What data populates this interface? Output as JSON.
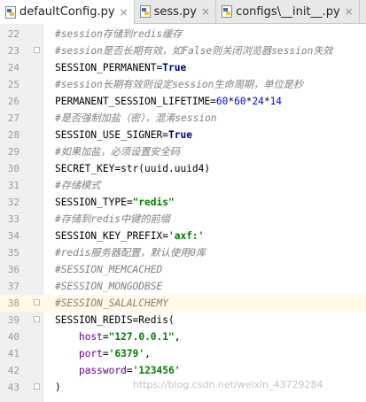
{
  "tabs": [
    {
      "label": "defaultConfig.py",
      "close": "×",
      "active": true
    },
    {
      "label": "sess.py",
      "close": "×",
      "active": false
    },
    {
      "label": "configs\\__init__.py",
      "close": "×",
      "active": false
    },
    {
      "label": "r",
      "close": "",
      "active": false
    }
  ],
  "lines": [
    {
      "num": "22",
      "segments": [
        {
          "t": "#session存储到redis缓存",
          "c": "comment"
        }
      ]
    },
    {
      "num": "23",
      "segments": [
        {
          "t": "#session是否长期有效，如False则关闭浏览器session失效",
          "c": "comment"
        }
      ]
    },
    {
      "num": "24",
      "segments": [
        {
          "t": "SESSION_PERMANENT=",
          "c": ""
        },
        {
          "t": "True",
          "c": "kw"
        }
      ]
    },
    {
      "num": "25",
      "segments": [
        {
          "t": "#session长期有效则设定session生命周期，单位是秒",
          "c": "comment"
        }
      ]
    },
    {
      "num": "26",
      "segments": [
        {
          "t": "PERMANENT_SESSION_LIFETIME=",
          "c": ""
        },
        {
          "t": "60",
          "c": "num"
        },
        {
          "t": "*",
          "c": ""
        },
        {
          "t": "60",
          "c": "num"
        },
        {
          "t": "*",
          "c": ""
        },
        {
          "t": "24",
          "c": "num"
        },
        {
          "t": "*",
          "c": ""
        },
        {
          "t": "14",
          "c": "num"
        }
      ]
    },
    {
      "num": "27",
      "segments": [
        {
          "t": "#是否强制加盐（密），混淆session",
          "c": "comment"
        }
      ]
    },
    {
      "num": "28",
      "segments": [
        {
          "t": "SESSION_USE_SIGNER=",
          "c": ""
        },
        {
          "t": "True",
          "c": "kw"
        }
      ]
    },
    {
      "num": "29",
      "segments": [
        {
          "t": "#如果加盐，必须设置安全码",
          "c": "comment"
        }
      ]
    },
    {
      "num": "30",
      "segments": [
        {
          "t": "SECRET_KEY=str(uuid.uuid4)",
          "c": ""
        }
      ]
    },
    {
      "num": "31",
      "segments": [
        {
          "t": "#存储模式",
          "c": "comment"
        }
      ]
    },
    {
      "num": "32",
      "segments": [
        {
          "t": "SESSION_TYPE=",
          "c": ""
        },
        {
          "t": "\"redis\"",
          "c": "str"
        }
      ]
    },
    {
      "num": "33",
      "segments": [
        {
          "t": "#存储到redis中键的前缀",
          "c": "comment"
        }
      ]
    },
    {
      "num": "34",
      "segments": [
        {
          "t": "SESSION_KEY_PREFIX=",
          "c": ""
        },
        {
          "t": "'axf:'",
          "c": "str"
        }
      ]
    },
    {
      "num": "35",
      "segments": [
        {
          "t": "#redis服务器配置，默认使用0库",
          "c": "comment"
        }
      ]
    },
    {
      "num": "36",
      "segments": [
        {
          "t": "#SESSION_MEMCACHED",
          "c": "comment"
        }
      ]
    },
    {
      "num": "37",
      "segments": [
        {
          "t": "#SESSION_MONGODBSE",
          "c": "comment"
        }
      ]
    },
    {
      "num": "38",
      "segments": [
        {
          "t": "#SESSION_SALALCHEMY",
          "c": "comment"
        }
      ]
    },
    {
      "num": "39",
      "segments": [
        {
          "t": "SESSION_REDIS=Redis(",
          "c": ""
        }
      ]
    },
    {
      "num": "40",
      "segments": [
        {
          "t": "    ",
          "c": ""
        },
        {
          "t": "host",
          "c": "param"
        },
        {
          "t": "=",
          "c": ""
        },
        {
          "t": "\"127.0.0.1\"",
          "c": "str"
        },
        {
          "t": ",",
          "c": ""
        }
      ]
    },
    {
      "num": "41",
      "segments": [
        {
          "t": "    ",
          "c": ""
        },
        {
          "t": "port",
          "c": "param"
        },
        {
          "t": "=",
          "c": ""
        },
        {
          "t": "'6379'",
          "c": "str"
        },
        {
          "t": ",",
          "c": ""
        }
      ]
    },
    {
      "num": "42",
      "segments": [
        {
          "t": "    ",
          "c": ""
        },
        {
          "t": "password",
          "c": "param"
        },
        {
          "t": "=",
          "c": ""
        },
        {
          "t": "'123456'",
          "c": "str"
        }
      ]
    },
    {
      "num": "43",
      "segments": [
        {
          "t": ")",
          "c": ""
        }
      ]
    }
  ],
  "current_line": "38",
  "fold_markers": [
    "23",
    "38",
    "39",
    "43"
  ],
  "watermark": "https://blog.csdn.net/weixin_43729284",
  "colors": {
    "comment": "#808080",
    "keyword": "#000080",
    "number": "#0000ff",
    "string": "#008000",
    "current_line": "#fffae3"
  }
}
